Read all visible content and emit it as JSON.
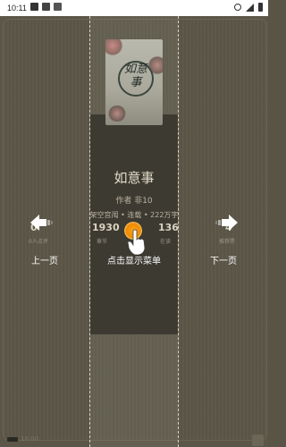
{
  "statusbar": {
    "time": "10:11"
  },
  "book": {
    "title": "如意事",
    "cover_text": "如意事",
    "author": "作者 非10",
    "meta": "架空宫闱 • 连载 • 222万字",
    "stats": [
      {
        "value": "0",
        "label": "0人点评"
      },
      {
        "value": "1930",
        "label": "章节"
      },
      {
        "value": "136",
        "label": "在读"
      },
      {
        "value": "4",
        "label": "推荐票"
      }
    ]
  },
  "nav": {
    "prev_label": "上一页",
    "menu_label": "点击显示菜单",
    "next_label": "下一页"
  },
  "footer": {
    "time": "10:00"
  },
  "colors": {
    "accent": "#f08a07",
    "background": "#5b5647"
  }
}
